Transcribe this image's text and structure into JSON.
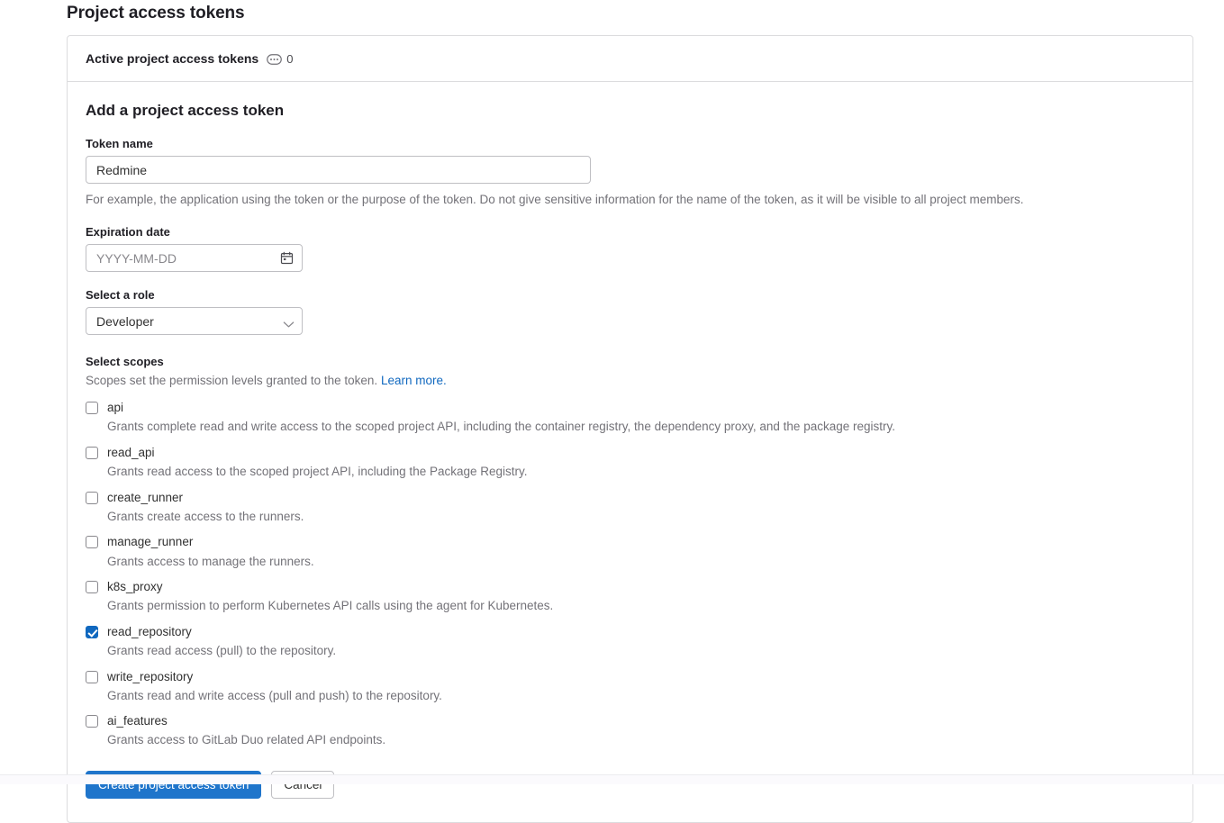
{
  "page": {
    "title": "Project access tokens"
  },
  "card": {
    "header": {
      "title": "Active project access tokens",
      "badge_icon": "token-badge-icon",
      "badge_count": "0"
    },
    "form": {
      "section_title": "Add a project access token",
      "token_name": {
        "label": "Token name",
        "value": "Redmine",
        "placeholder": "",
        "help": "For example, the application using the token or the purpose of the token. Do not give sensitive information for the name of the token, as it will be visible to all project members."
      },
      "expiration_date": {
        "label": "Expiration date",
        "value": "",
        "placeholder": "YYYY-MM-DD",
        "icon": "calendar-icon"
      },
      "role": {
        "label": "Select a role",
        "selected": "Developer",
        "icon": "chevron-down-icon",
        "options": [
          "Developer"
        ]
      },
      "scopes": {
        "label": "Select scopes",
        "description": "Scopes set the permission levels granted to the token.",
        "learn_more": "Learn more.",
        "items": [
          {
            "name": "api",
            "checked": false,
            "description": "Grants complete read and write access to the scoped project API, including the container registry, the dependency proxy, and the package registry."
          },
          {
            "name": "read_api",
            "checked": false,
            "description": "Grants read access to the scoped project API, including the Package Registry."
          },
          {
            "name": "create_runner",
            "checked": false,
            "description": "Grants create access to the runners."
          },
          {
            "name": "manage_runner",
            "checked": false,
            "description": "Grants access to manage the runners."
          },
          {
            "name": "k8s_proxy",
            "checked": false,
            "description": "Grants permission to perform Kubernetes API calls using the agent for Kubernetes."
          },
          {
            "name": "read_repository",
            "checked": true,
            "description": "Grants read access (pull) to the repository."
          },
          {
            "name": "write_repository",
            "checked": false,
            "description": "Grants read and write access (pull and push) to the repository."
          },
          {
            "name": "ai_features",
            "checked": false,
            "description": "Grants access to GitLab Duo related API endpoints."
          }
        ]
      },
      "actions": {
        "submit_label": "Create project access token",
        "cancel_label": "Cancel"
      }
    }
  },
  "colors": {
    "primary_blue": "#1f75cb",
    "link_blue": "#1068bf",
    "checkbox_checked": "#1068bf",
    "border": "#dcdcde",
    "text": "#303030",
    "muted_text": "#737278"
  }
}
